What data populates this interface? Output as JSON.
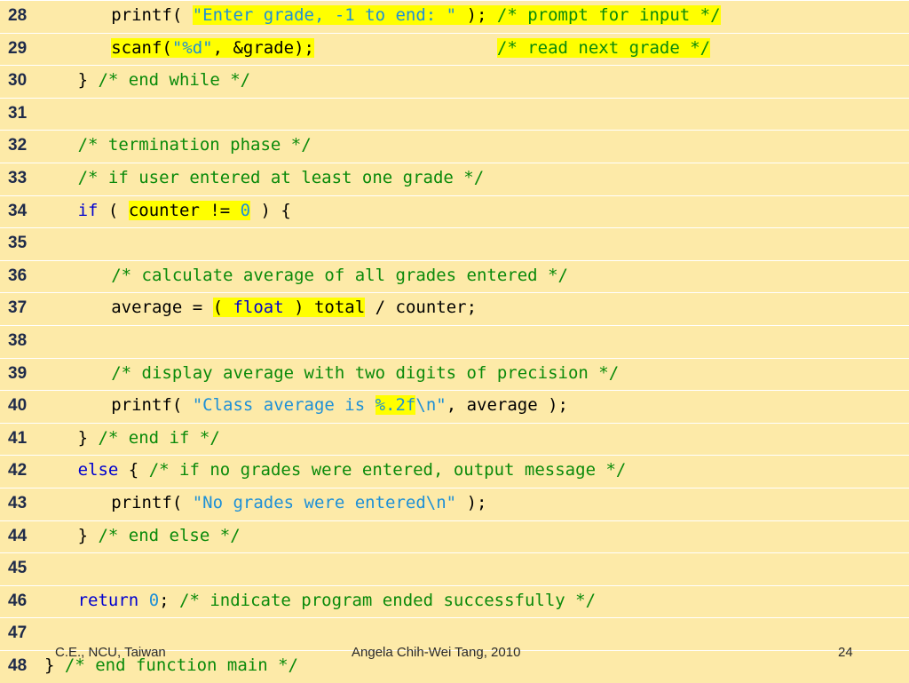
{
  "lines": [
    {
      "n": "28",
      "indent": 2,
      "tokens": [
        {
          "t": "printf( "
        },
        {
          "t": "\"Enter grade, -1 to end: \"",
          "k": "s",
          "h": true
        },
        {
          "t": " ); ",
          "h": true
        },
        {
          "t": "/* prompt for input */",
          "k": "c",
          "h": true
        }
      ]
    },
    {
      "n": "29",
      "indent": 2,
      "tokens": [
        {
          "t": "scanf(",
          "h": true
        },
        {
          "t": "\"%d\"",
          "k": "s",
          "h": true
        },
        {
          "t": ", &grade);",
          "h": true
        },
        {
          "t": "                  "
        },
        {
          "t": "/* read next grade */",
          "k": "c",
          "h": true
        }
      ]
    },
    {
      "n": "30",
      "indent": 1,
      "tokens": [
        {
          "t": "} "
        },
        {
          "t": "/* end while */",
          "k": "c"
        }
      ]
    },
    {
      "n": "31",
      "indent": 0,
      "tokens": []
    },
    {
      "n": "32",
      "indent": 1,
      "tokens": [
        {
          "t": "/* termination phase */",
          "k": "c"
        }
      ]
    },
    {
      "n": "33",
      "indent": 1,
      "tokens": [
        {
          "t": "/* if user entered at least one grade */",
          "k": "c"
        }
      ]
    },
    {
      "n": "34",
      "indent": 1,
      "tokens": [
        {
          "t": "if",
          "k": "k"
        },
        {
          "t": " ( "
        },
        {
          "t": "counter != ",
          "h": true
        },
        {
          "t": "0",
          "k": "n",
          "h": true
        },
        {
          "t": " ) {"
        }
      ]
    },
    {
      "n": "35",
      "indent": 0,
      "tokens": []
    },
    {
      "n": "36",
      "indent": 2,
      "tokens": [
        {
          "t": "/* calculate average of all grades entered */",
          "k": "c"
        }
      ]
    },
    {
      "n": "37",
      "indent": 2,
      "tokens": [
        {
          "t": "average = "
        },
        {
          "t": "( ",
          "h": true
        },
        {
          "t": "float",
          "k": "k",
          "h": true
        },
        {
          "t": " ) total",
          "h": true
        },
        {
          "t": " / counter;"
        }
      ]
    },
    {
      "n": "38",
      "indent": 0,
      "tokens": []
    },
    {
      "n": "39",
      "indent": 2,
      "tokens": [
        {
          "t": "/* display average with two digits of precision */",
          "k": "c"
        }
      ]
    },
    {
      "n": "40",
      "indent": 2,
      "tokens": [
        {
          "t": "printf( "
        },
        {
          "t": "\"Class average is ",
          "k": "s"
        },
        {
          "t": "%.2f",
          "k": "s",
          "h": true
        },
        {
          "t": "\\n\"",
          "k": "s"
        },
        {
          "t": ", average );"
        }
      ]
    },
    {
      "n": "41",
      "indent": 1,
      "tokens": [
        {
          "t": "} "
        },
        {
          "t": "/* end if */",
          "k": "c"
        }
      ]
    },
    {
      "n": "42",
      "indent": 1,
      "tokens": [
        {
          "t": "else",
          "k": "k"
        },
        {
          "t": " { "
        },
        {
          "t": "/* if no grades were entered, output message */",
          "k": "c"
        }
      ]
    },
    {
      "n": "43",
      "indent": 2,
      "tokens": [
        {
          "t": "printf( "
        },
        {
          "t": "\"No grades were entered\\n\"",
          "k": "s"
        },
        {
          "t": " );"
        }
      ]
    },
    {
      "n": "44",
      "indent": 1,
      "tokens": [
        {
          "t": "} "
        },
        {
          "t": "/* end else */",
          "k": "c"
        }
      ]
    },
    {
      "n": "45",
      "indent": 0,
      "tokens": []
    },
    {
      "n": "46",
      "indent": 1,
      "tokens": [
        {
          "t": "return",
          "k": "k"
        },
        {
          "t": " "
        },
        {
          "t": "0",
          "k": "n"
        },
        {
          "t": "; "
        },
        {
          "t": "/* indicate program ended successfully */",
          "k": "c"
        }
      ]
    },
    {
      "n": "47",
      "indent": 0,
      "tokens": []
    },
    {
      "n": "48",
      "indent": 0,
      "tokens": [
        {
          "t": "} "
        },
        {
          "t": "/* end function main */",
          "k": "c"
        }
      ]
    }
  ],
  "footer": {
    "left": "C.E., NCU, Taiwan",
    "center": "Angela Chih-Wei Tang, 2010",
    "page": "24"
  },
  "colors": {
    "background": "#fdeaa8",
    "highlight": "#ffff00",
    "string": "#1e90d6",
    "comment": "#0a8a0a",
    "keyword": "#0000d0"
  }
}
